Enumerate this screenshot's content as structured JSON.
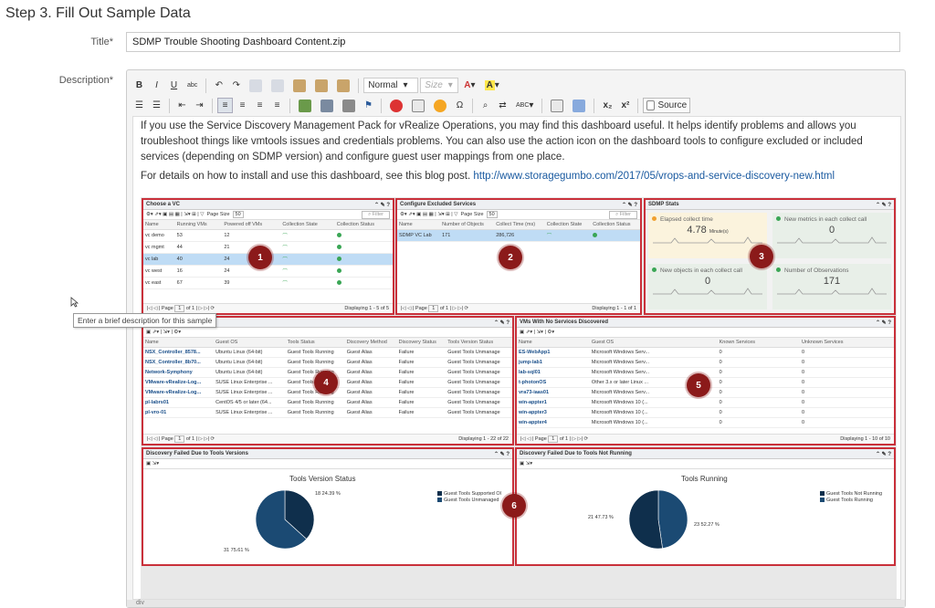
{
  "step_title": "Step 3. Fill Out Sample Data",
  "title_label": "Title*",
  "title_value": "SDMP Trouble Shooting Dashboard Content.zip",
  "description_label": "Description*",
  "toolbar": {
    "bold": "B",
    "italic": "I",
    "underline": "U",
    "strike": "abc",
    "format_select": "Normal",
    "size_select": "Size",
    "source_label": "Source",
    "sub": "x₂",
    "sup": "x²"
  },
  "body": {
    "para1": "If you use the Service Discovery Management Pack for vRealize Operations, you may find this dashboard useful.  It helps identify problems and allows you troubleshoot things like vmtools issues and credentials problems.  You can also use the action icon on the dashboard tools to configure excluded or included services (depending on SDMP version) and configure guest user mappings from one place.",
    "para2_prefix": "For details on how to install and use this dashboard, see this blog post.  ",
    "para2_link": "http://www.storagegumbo.com/2017/05/vrops-and-service-discovery-new.html"
  },
  "tooltip": "Enter a brief description for this sample",
  "statusbar": "div",
  "dashboard": {
    "choose_vc": {
      "title": "Choose a VC",
      "page_size_label": "Page Size",
      "page_size": "50",
      "filter": "Filter",
      "columns": [
        "Name",
        "Running VMs",
        "Powered off VMs",
        "Collection State",
        "Collection Status"
      ],
      "rows": [
        [
          "vc demo",
          "53",
          "12"
        ],
        [
          "vc mgmt",
          "44",
          "21"
        ],
        [
          "vc lab",
          "40",
          "24"
        ],
        [
          "vc west",
          "16",
          "24"
        ],
        [
          "vc east",
          "67",
          "39"
        ]
      ],
      "page_text": "Page",
      "page_num": "1",
      "page_of": "of 1",
      "displaying": "Displaying 1 - 5 of 5"
    },
    "excluded_services": {
      "title": "Configure Excluded Services",
      "page_size_label": "Page Size",
      "page_size": "50",
      "filter": "Filter",
      "columns": [
        "Name",
        "Number of Objects",
        "Collect Time (ms)",
        "Collection State",
        "Collection Status"
      ],
      "rows": [
        [
          "SDMP VC Lab",
          "171",
          "286,726"
        ]
      ],
      "page_text": "Page",
      "page_num": "1",
      "page_of": "of 1",
      "displaying": "Displaying 1 - 1 of 1"
    },
    "sdmp_stats": {
      "title": "SDMP Stats",
      "tiles": [
        {
          "label": "Elapsed collect time",
          "value": "4.78",
          "unit": "Minute(s)",
          "color": "#f0a030"
        },
        {
          "label": "New metrics in each collect call",
          "value": "0",
          "unit": "",
          "color": "#3aa655"
        },
        {
          "label": "New objects in each collect call",
          "value": "0",
          "unit": "",
          "color": "#3aa655"
        },
        {
          "label": "Number of Observations",
          "value": "171",
          "unit": "",
          "color": "#3aa655"
        }
      ]
    },
    "tools_grid": {
      "columns": [
        "Name",
        "Guest OS",
        "Tools Status",
        "Discovery Method",
        "Discovery Status",
        "Tools Version Status"
      ],
      "rows": [
        [
          "NSX_Controller_8578...",
          "Ubuntu Linux (64-bit)",
          "Guest Tools Running",
          "Guest Alias",
          "Failure",
          "Guest Tools Unmanage"
        ],
        [
          "NSX_Controller_8b70...",
          "Ubuntu Linux (64-bit)",
          "Guest Tools Running",
          "Guest Alias",
          "Failure",
          "Guest Tools Unmanage"
        ],
        [
          "Network-Symphony",
          "Ubuntu Linux (64-bit)",
          "Guest Tools Running",
          "Guest Alias",
          "Failure",
          "Guest Tools Unmanage"
        ],
        [
          "VMware-vRealize-Log...",
          "SUSE Linux Enterprise ...",
          "Guest Tools Running",
          "Guest Alias",
          "Failure",
          "Guest Tools Unmanage"
        ],
        [
          "VMware-vRealize-Log...",
          "SUSE Linux Enterprise ...",
          "Guest Tools Running",
          "Guest Alias",
          "Failure",
          "Guest Tools Unmanage"
        ],
        [
          "pl-labrs01",
          "CentOS 4/5 or later (64...",
          "Guest Tools Running",
          "Guest Alias",
          "Failure",
          "Guest Tools Unmanage"
        ],
        [
          "pl-vro-01",
          "SUSE Linux Enterprise ...",
          "Guest Tools Running",
          "Guest Alias",
          "Failure",
          "Guest Tools Unmanage"
        ]
      ],
      "page_text": "Page",
      "page_num": "1",
      "page_of": "of 1",
      "displaying": "Displaying 1 - 22 of 22"
    },
    "no_services": {
      "title": "VMs With No Services Discovered",
      "columns": [
        "Name",
        "Guest OS",
        "Known Services",
        "Unknown Services"
      ],
      "rows": [
        [
          "ES-WebApp1",
          "Microsoft Windows Serv...",
          "0",
          "0"
        ],
        [
          "jump-lab1",
          "Microsoft Windows Serv...",
          "0",
          "0"
        ],
        [
          "lab-sql01",
          "Microsoft Windows Serv...",
          "0",
          "0"
        ],
        [
          "t-photonOS",
          "Other 3.x or later Linux ...",
          "0",
          "0"
        ],
        [
          "vra73-iaas01",
          "Microsoft Windows Serv...",
          "0",
          "0"
        ],
        [
          "win-appter1",
          "Microsoft Windows 10 (...",
          "0",
          "0"
        ],
        [
          "win-appter3",
          "Microsoft Windows 10 (...",
          "0",
          "0"
        ],
        [
          "win-appter4",
          "Microsoft Windows 10 (...",
          "0",
          "0"
        ]
      ],
      "page_text": "Page",
      "page_num": "1",
      "page_of": "of 1",
      "displaying": "Displaying 1 - 10 of 10"
    },
    "failed_versions": {
      "title": "Discovery Failed Due to Tools Versions",
      "chart_title": "Tools Version Status",
      "slice_labels": [
        "18 24.39 %",
        "31 75.61 %"
      ],
      "legend": [
        "Guest Tools Supported Ol",
        "Guest Tools Unmanaged"
      ]
    },
    "failed_running": {
      "title": "Discovery Failed Due to Tools Not Running",
      "chart_title": "Tools Running",
      "slice_labels": [
        "21 47.73 %",
        "23 52.27 %"
      ],
      "legend": [
        "Guest Tools Not Running",
        "Guest Tools Running"
      ]
    },
    "badges": [
      "1",
      "2",
      "3",
      "4",
      "5",
      "6"
    ]
  },
  "chart_data": [
    {
      "type": "pie",
      "title": "Tools Version Status",
      "categories": [
        "Guest Tools Supported Ol",
        "Guest Tools Unmanaged"
      ],
      "values": [
        18,
        31
      ],
      "percent": [
        24.39,
        75.61
      ],
      "colors": [
        "#0f2f4c",
        "#1b4a73"
      ]
    },
    {
      "type": "pie",
      "title": "Tools Running",
      "categories": [
        "Guest Tools Not Running",
        "Guest Tools Running"
      ],
      "values": [
        21,
        23
      ],
      "percent": [
        47.73,
        52.27
      ],
      "colors": [
        "#1b4a73",
        "#0f2f4c"
      ]
    }
  ]
}
